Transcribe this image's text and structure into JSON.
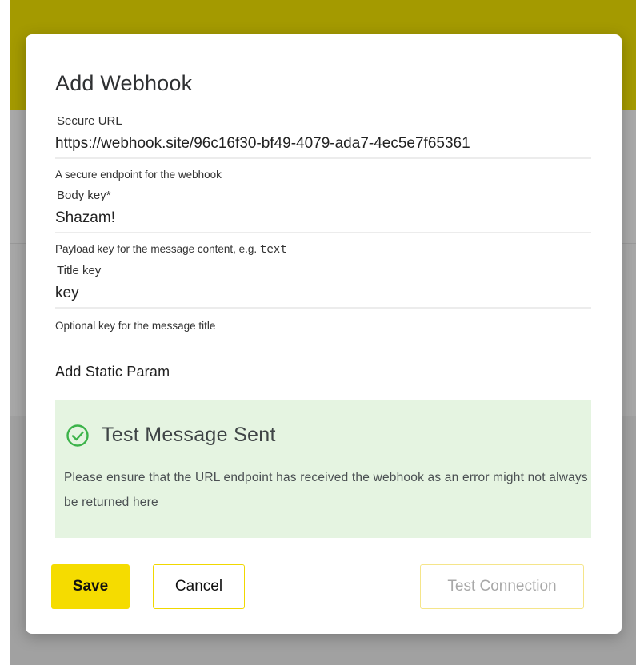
{
  "modal": {
    "title": "Add Webhook",
    "fields": [
      {
        "label": "Secure URL",
        "value": "https://webhook.site/96c16f30-bf49-4079-ada7-4ec5e7f65361",
        "help": "A secure endpoint for the webhook"
      },
      {
        "label": "Body key*",
        "value": "Shazam!",
        "help_prefix": "Payload key for the message content, e.g.",
        "help_code": "text"
      },
      {
        "label": "Title key",
        "value": "key",
        "help": "Optional key for the message title"
      }
    ],
    "add_static_param": "Add Static Param",
    "alert": {
      "icon": "check-circle-icon",
      "title": "Test Message Sent",
      "body": "Please ensure that the URL endpoint has received the webhook as an error might not always be returned here"
    },
    "buttons": {
      "save": "Save",
      "cancel": "Cancel",
      "test_connection": "Test Connection"
    }
  },
  "colors": {
    "accent_yellow": "#f5dc00",
    "alert_background": "#e5f4e1",
    "alert_icon": "#3cb34a",
    "header_band": "#a49a00"
  }
}
